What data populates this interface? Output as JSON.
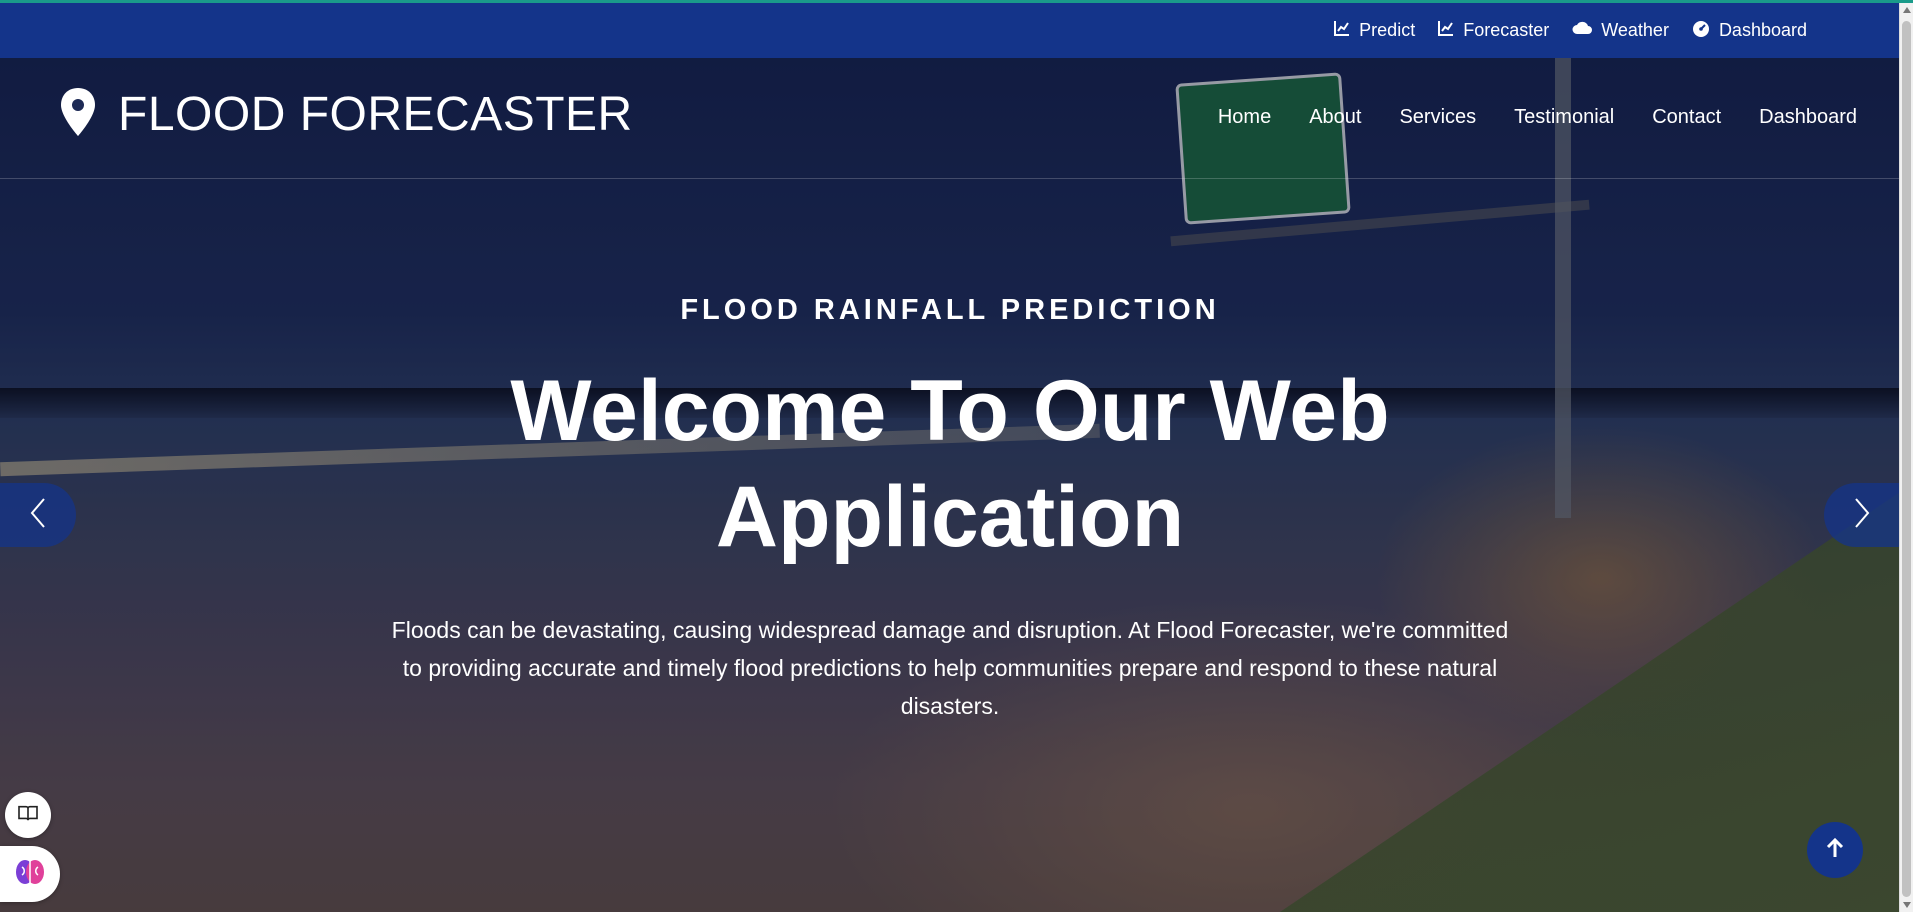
{
  "topbar": {
    "links": [
      {
        "label": "Predict",
        "icon": "chart-line-icon"
      },
      {
        "label": "Forecaster",
        "icon": "chart-line-icon"
      },
      {
        "label": "Weather",
        "icon": "cloud-icon"
      },
      {
        "label": "Dashboard",
        "icon": "gauge-icon"
      }
    ]
  },
  "brand": {
    "title": "FLOOD FORECASTER",
    "icon": "map-pin-icon"
  },
  "nav": {
    "items": [
      "Home",
      "About",
      "Services",
      "Testimonial",
      "Contact",
      "Dashboard"
    ]
  },
  "hero": {
    "kicker": "FLOOD RAINFALL PREDICTION",
    "headline": "Welcome To Our Web Application",
    "description": "Floods can be devastating, causing widespread damage and disruption. At Flood Forecaster, we're committed to providing accurate and timely flood predictions to help communities prepare and respond to these natural disasters."
  },
  "controls": {
    "prev_icon": "chevron-left-icon",
    "next_icon": "chevron-right-icon",
    "back_to_top_icon": "arrow-up-icon",
    "reader_icon": "book-reader-icon",
    "ai_icon": "brain-icon"
  },
  "colors": {
    "primary": "#14348a",
    "accent_line": "#1a9b8a",
    "text": "#ffffff"
  }
}
